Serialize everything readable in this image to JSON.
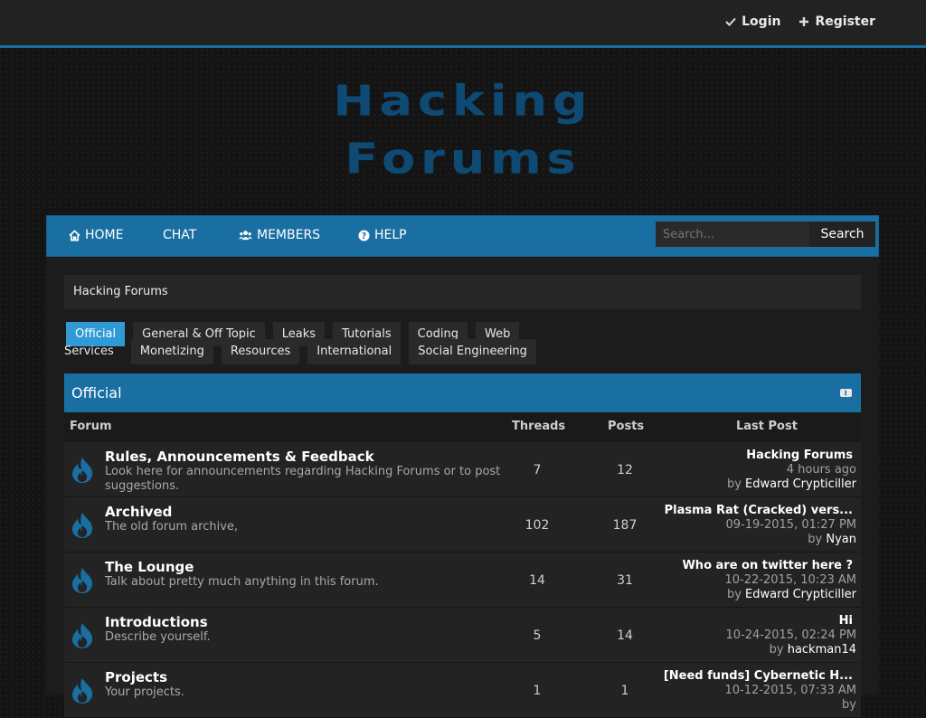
{
  "top_links": {
    "login": "Login",
    "register": "Register"
  },
  "logo": {
    "line1": "Hacking",
    "line2": "Forums"
  },
  "nav": {
    "home": "HOME",
    "chat": "CHAT",
    "members": "MEMBERS",
    "help": "HELP",
    "search_placeholder": "Search...",
    "search_button": "Search"
  },
  "breadcrumb": "Hacking Forums",
  "tabs_row1": [
    "Official",
    "General & Off Topic",
    "Leaks",
    "Tutorials",
    "Coding",
    "Web"
  ],
  "tabs_row2": [
    "Services",
    "Monetizing",
    "Resources",
    "International",
    "Social Engineering"
  ],
  "category": {
    "title": "Official"
  },
  "columns": {
    "forum": "Forum",
    "threads": "Threads",
    "posts": "Posts",
    "last_post": "Last Post"
  },
  "forums": [
    {
      "title": "Rules, Announcements & Feedback",
      "desc": "Look here for announcements regarding Hacking Forums or to post suggestions.",
      "threads": "7",
      "posts": "12",
      "last_title": "Hacking Forums",
      "last_date": "4 hours ago",
      "by": "by",
      "last_user": "Edward Crypticiller"
    },
    {
      "title": "Archived",
      "desc": "The old forum archive,",
      "threads": "102",
      "posts": "187",
      "last_title": "Plasma Rat (Cracked) vers...",
      "last_date": "09-19-2015, 01:27 PM",
      "by": "by",
      "last_user": "Nyan"
    },
    {
      "title": "The Lounge",
      "desc": "Talk about pretty much anything in this forum.",
      "threads": "14",
      "posts": "31",
      "last_title": "Who are on twitter here ?",
      "last_date": "10-22-2015, 10:23 AM",
      "by": "by",
      "last_user": "Edward Crypticiller"
    },
    {
      "title": "Introductions",
      "desc": "Describe yourself.",
      "threads": "5",
      "posts": "14",
      "last_title": "Hi",
      "last_date": "10-24-2015, 02:24 PM",
      "by": "by",
      "last_user": "hackman14"
    },
    {
      "title": "Projects",
      "desc": "Your projects.",
      "threads": "1",
      "posts": "1",
      "last_title": "[Need funds] Cybernetic H...",
      "last_date": "10-12-2015, 07:33 AM",
      "by": "by",
      "last_user": ""
    }
  ],
  "colors": {
    "accent": "#1a6fa2",
    "active_tab": "#2f9ad6",
    "logo": "#0f4a74"
  }
}
